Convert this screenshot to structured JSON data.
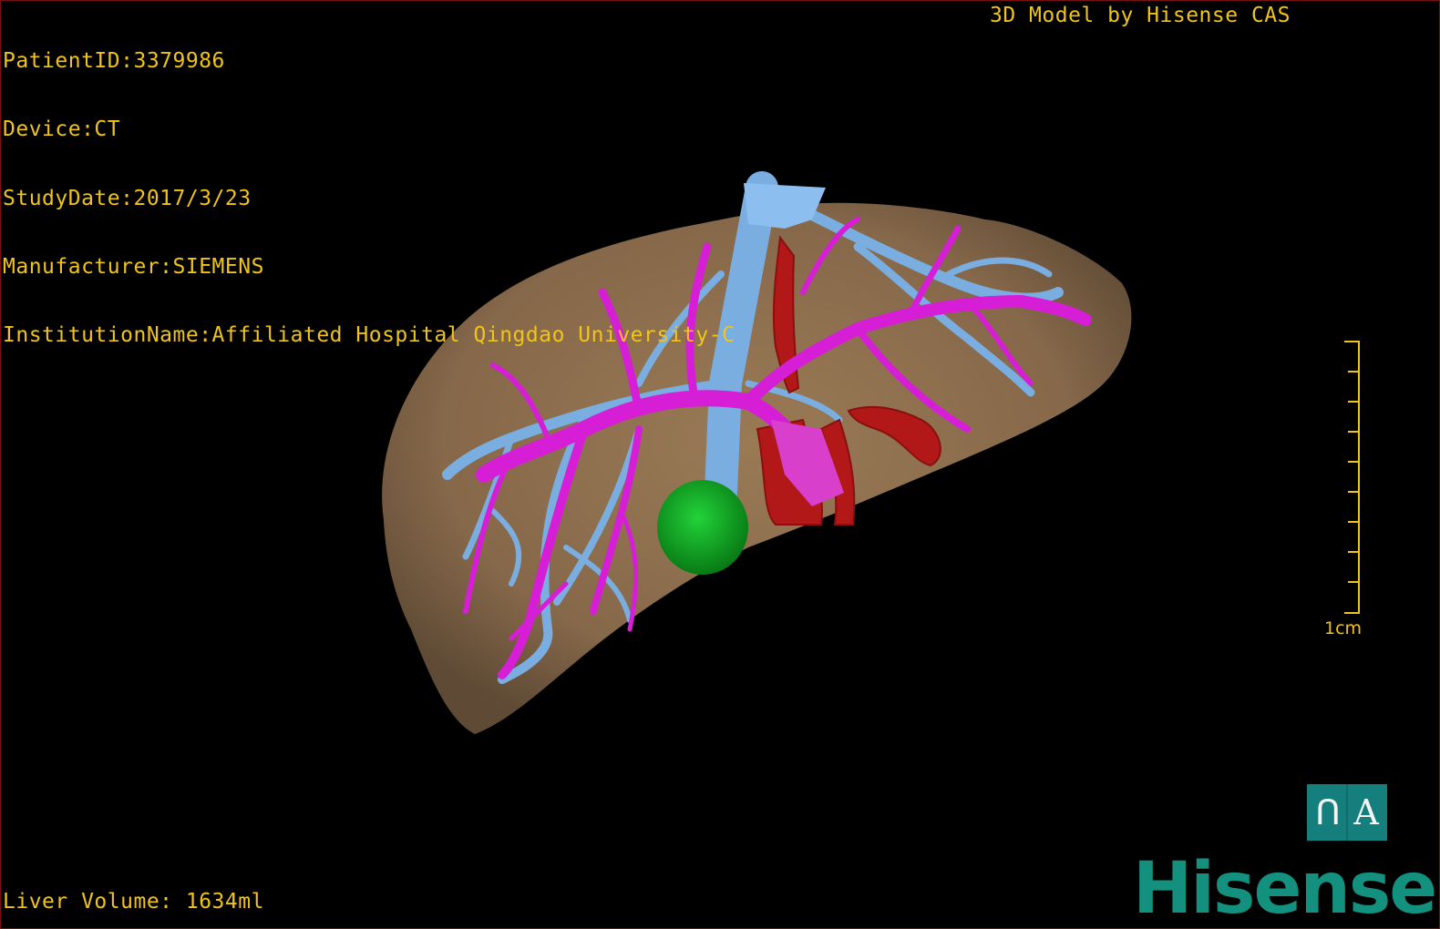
{
  "viewer": {
    "info_lines": [
      "PatientID:3379986",
      "Device:CT",
      "StudyDate:2017/3/23",
      "Manufacturer:SIEMENS",
      "InstitutionName:Affiliated Hospital Qingdao University-C"
    ],
    "credit": "3D Model by Hisense CAS",
    "volume": "Liver Volume: 1634ml",
    "scale_label": "1cm",
    "text_color": "#f0c419"
  },
  "mode_button": {
    "glyph_left": "ꓵ",
    "glyph_right": "A",
    "color": "#147f7c"
  },
  "brand": {
    "logo": "Hisense",
    "color": "#14907f"
  },
  "model": {
    "structures": [
      {
        "name": "liver",
        "color": "#8c6e4b"
      },
      {
        "name": "hepatic-veins",
        "color": "#7aaee0"
      },
      {
        "name": "portal-vein",
        "color": "#d61ed6"
      },
      {
        "name": "arteries",
        "color": "#b21818"
      },
      {
        "name": "gallbladder",
        "color": "#0fae26"
      }
    ]
  }
}
